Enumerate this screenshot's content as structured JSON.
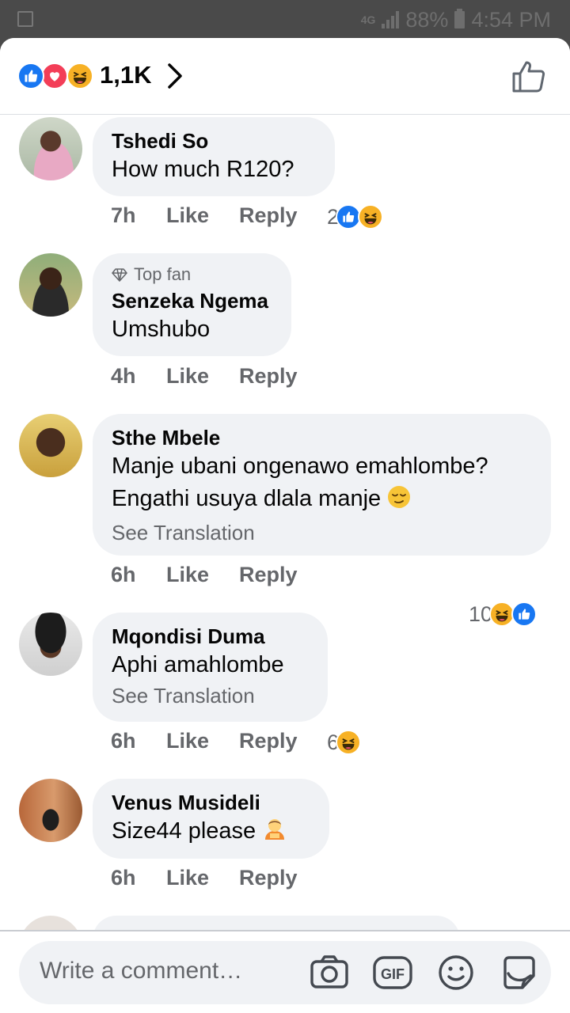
{
  "status_bar": {
    "network": "4G",
    "battery": "88%",
    "time": "4:54 PM"
  },
  "reactions": {
    "count": "1,1K",
    "icons": [
      "like-icon",
      "love-icon",
      "haha-icon"
    ]
  },
  "comments": [
    {
      "name": "Tshedi So",
      "text": "How much R120?",
      "time": "7h",
      "like": "Like",
      "reply": "Reply",
      "reaction_count": "2",
      "reactions": [
        "like",
        "haha"
      ]
    },
    {
      "badge": "Top fan",
      "name": "Senzeka Ngema",
      "text": "Umshubo",
      "time": "4h",
      "like": "Like",
      "reply": "Reply"
    },
    {
      "name": "Sthe Mbele",
      "text_line1": "Manje ubani ongenawo emahlombe?",
      "text_line2": "Engathi usuya dlala manje",
      "translate": "See Translation",
      "time": "6h",
      "like": "Like",
      "reply": "Reply",
      "reaction_count": "10",
      "reactions": [
        "haha",
        "like"
      ]
    },
    {
      "name": "Mqondisi Duma",
      "text": "Aphi amahlombe",
      "translate": "See Translation",
      "time": "6h",
      "like": "Like",
      "reply": "Reply",
      "reaction_count": "6",
      "reactions": [
        "haha"
      ]
    },
    {
      "name": "Venus Musideli",
      "text": "Size44 please",
      "time": "6h",
      "like": "Like",
      "reply": "Reply"
    }
  ],
  "composer": {
    "placeholder": "Write a comment…",
    "icons": [
      "camera-icon",
      "gif-icon",
      "emoji-icon",
      "sticker-icon"
    ]
  },
  "colors": {
    "like": "#1877f2",
    "love": "#f33e58",
    "haha": "#f7b125",
    "bubble": "#f0f2f5",
    "meta": "#65676b"
  }
}
